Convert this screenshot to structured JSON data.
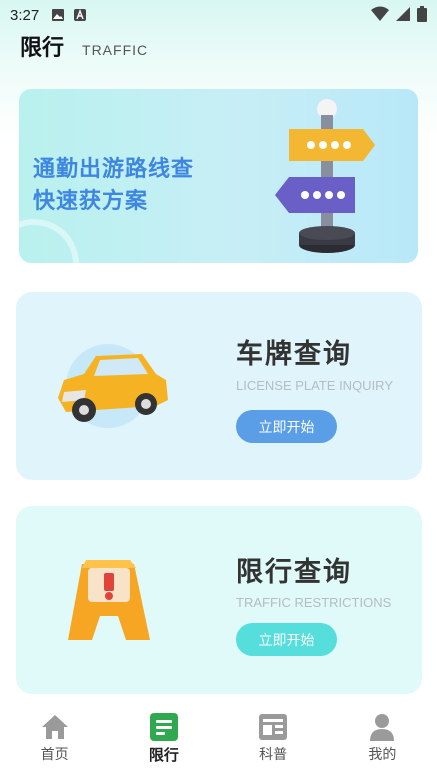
{
  "status_bar": {
    "time": "3:27"
  },
  "header": {
    "title": "限行",
    "subtitle": "TRAFFIC"
  },
  "banner": {
    "line1": "通勤出游路线查",
    "line2": "快速获方案"
  },
  "cards": [
    {
      "title": "车牌查询",
      "subtitle": "LICENSE PLATE INQUIRY",
      "button": "立即开始",
      "button_color": "#5b9ee8"
    },
    {
      "title": "限行查询",
      "subtitle": "TRAFFIC RESTRICTIONS",
      "button": "立即开始",
      "button_color": "#55dedc"
    }
  ],
  "nav": {
    "items": [
      {
        "label": "首页",
        "icon": "home-icon"
      },
      {
        "label": "限行",
        "icon": "traffic-limit-icon",
        "active": true
      },
      {
        "label": "科普",
        "icon": "news-icon"
      },
      {
        "label": "我的",
        "icon": "profile-icon"
      }
    ],
    "active_color": "#2fa84f"
  }
}
